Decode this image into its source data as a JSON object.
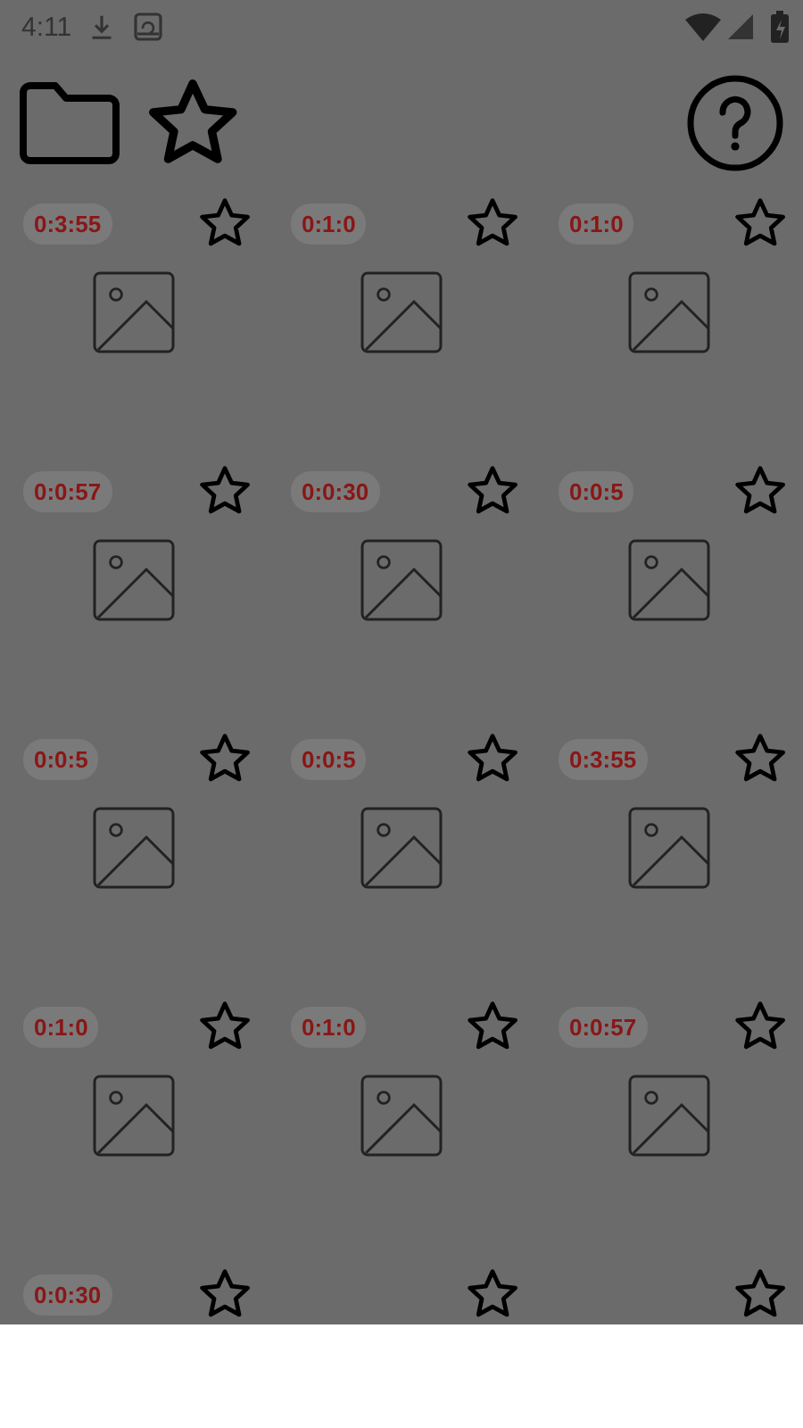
{
  "status_bar": {
    "time": "4:11"
  },
  "items": [
    {
      "kind": "badge",
      "duration": "0:3:55"
    },
    {
      "kind": "badge",
      "duration": "0:1:0"
    },
    {
      "kind": "badge",
      "duration": "0:1:0"
    },
    {
      "kind": "badge",
      "duration": "0:0:57"
    },
    {
      "kind": "badge",
      "duration": "0:0:30"
    },
    {
      "kind": "badge",
      "duration": "0:0:5"
    },
    {
      "kind": "badge",
      "duration": "0:0:5"
    },
    {
      "kind": "badge",
      "duration": "0:0:5"
    },
    {
      "kind": "badge",
      "duration": "0:3:55"
    },
    {
      "kind": "badge",
      "duration": "0:1:0"
    },
    {
      "kind": "badge",
      "duration": "0:1:0"
    },
    {
      "kind": "badge",
      "duration": "0:0:57"
    },
    {
      "kind": "badge",
      "duration": "0:0:30"
    },
    {
      "kind": "plain"
    },
    {
      "kind": "plain"
    }
  ]
}
